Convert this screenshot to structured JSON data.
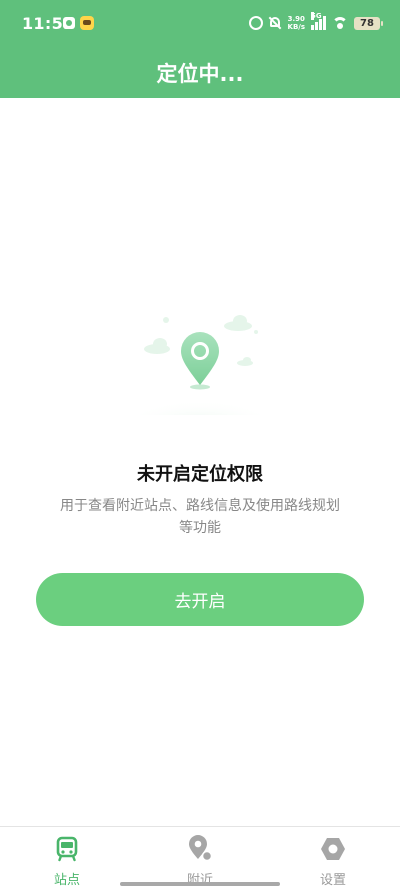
{
  "status_bar": {
    "time": "11:53",
    "net_speed_value": "3.90",
    "net_speed_unit": "KB/s",
    "network": "5G",
    "battery": "78"
  },
  "header": {
    "title": "定位中..."
  },
  "empty_state": {
    "heading": "未开启定位权限",
    "description": "用于查看附近站点、路线信息及使用路线规划等功能",
    "button_label": "去开启"
  },
  "tabbar": {
    "items": [
      {
        "label": "站点",
        "icon": "bus-icon",
        "active": true
      },
      {
        "label": "附近",
        "icon": "location-icon",
        "active": false
      },
      {
        "label": "设置",
        "icon": "settings-icon",
        "active": false
      }
    ]
  },
  "colors": {
    "primary": "#5fc07c",
    "button": "#6bcf7f",
    "active_tab": "#49b56a",
    "inactive_tab": "#9a9a9a",
    "description_text": "#888888"
  }
}
